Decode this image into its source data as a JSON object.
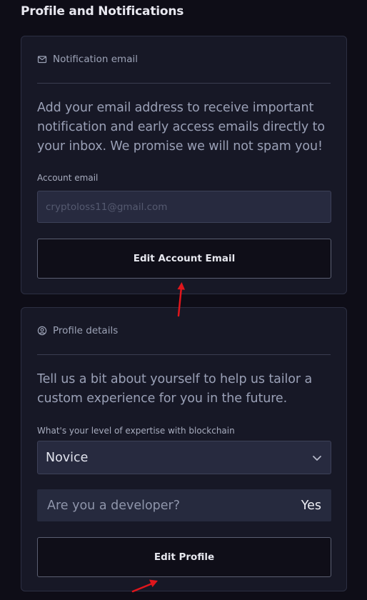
{
  "page": {
    "title": "Profile and Notifications"
  },
  "notification_email": {
    "header": "Notification email",
    "icon": "mail-icon",
    "description": "Add your email address to receive important notification and early access emails directly to your inbox. We promise we will not spam you!",
    "field_label": "Account email",
    "email_value": "cryptoloss11@gmail.com",
    "button_label": "Edit Account Email"
  },
  "profile_details": {
    "header": "Profile details",
    "icon": "user-circle-icon",
    "description": "Tell us a bit about yourself to help us tailor a custom experience for you in the future.",
    "expertise_label": "What's your level of expertise with blockchain",
    "expertise_value": "Novice",
    "developer_question": "Are you a developer?",
    "developer_answer": "Yes",
    "button_label": "Edit Profile"
  },
  "colors": {
    "background": "#0e0d17",
    "card": "#171826",
    "input": "#272a3f",
    "annotation_arrow": "#e0161c"
  }
}
